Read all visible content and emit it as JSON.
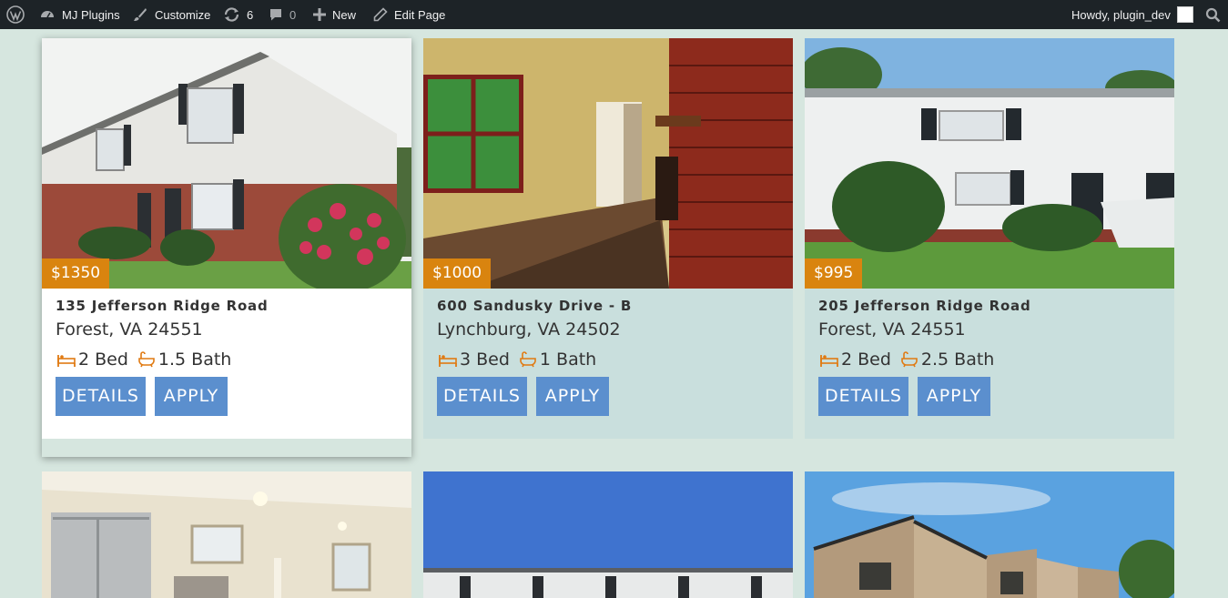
{
  "adminbar": {
    "site_name": "MJ Plugins",
    "customize": "Customize",
    "updates_count": "6",
    "comments_count": "0",
    "new_label": "New",
    "edit_page": "Edit Page",
    "howdy": "Howdy, plugin_dev"
  },
  "listings": [
    {
      "price": "$1350",
      "street": "135 Jefferson Ridge Road",
      "city": "Forest, VA 24551",
      "beds": "2 Bed",
      "baths": "1.5 Bath",
      "details": "DETAILS",
      "apply": "APPLY"
    },
    {
      "price": "$1000",
      "street": "600 Sandusky Drive - B",
      "city": "Lynchburg, VA 24502",
      "beds": "3 Bed",
      "baths": "1 Bath",
      "details": "DETAILS",
      "apply": "APPLY"
    },
    {
      "price": "$995",
      "street": "205 Jefferson Ridge Road",
      "city": "Forest, VA 24551",
      "beds": "2 Bed",
      "baths": "2.5 Bath",
      "details": "DETAILS",
      "apply": "APPLY"
    }
  ],
  "colors": {
    "accent_price": "#d9840f",
    "button": "#5b8fce",
    "page_bg": "#d6e6df",
    "card_bg": "#c9dfdd",
    "icon": "#e07a12"
  }
}
